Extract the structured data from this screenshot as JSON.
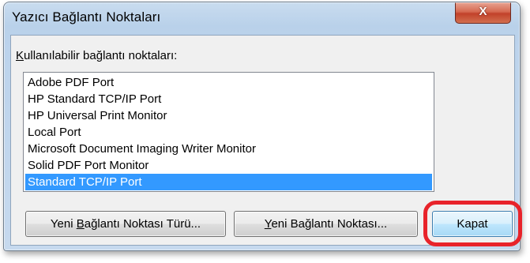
{
  "window": {
    "title": "Yazıcı Bağlantı Noktaları",
    "close_label": "X"
  },
  "ports_label": "Kullanılabilir bağlantı noktaları:",
  "ports": [
    "Adobe PDF Port",
    "HP Standard TCP/IP Port",
    "HP Universal Print Monitor",
    "Local Port",
    "Microsoft Document Imaging Writer Monitor",
    "Solid PDF Port Monitor",
    "Standard TCP/IP Port"
  ],
  "selected_port": "Standard TCP/IP Port",
  "buttons": {
    "new_port_type": "Yeni Bağlantı Noktası Türü...",
    "new_port": "Yeni Bağlantı Noktası...",
    "close": "Kapat"
  },
  "colors": {
    "selection": "#3399ff",
    "highlight_ring": "#e8232a"
  }
}
